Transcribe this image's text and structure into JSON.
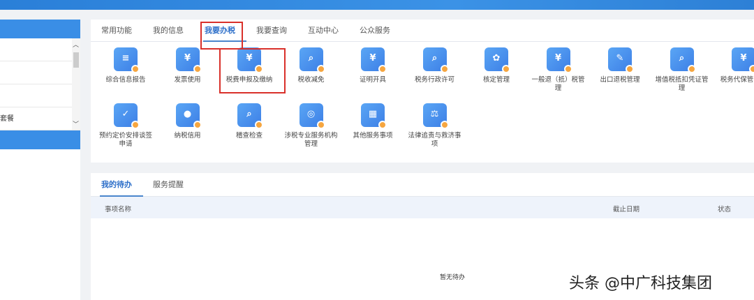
{
  "sidebar": {
    "rows": [
      "",
      "",
      "",
      "套餐"
    ]
  },
  "top_tabs": [
    {
      "label": "常用功能",
      "active": false
    },
    {
      "label": "我的信息",
      "active": false
    },
    {
      "label": "我要办税",
      "active": true
    },
    {
      "label": "我要查询",
      "active": false
    },
    {
      "label": "互动中心",
      "active": false
    },
    {
      "label": "公众服务",
      "active": false
    }
  ],
  "services_row1": [
    {
      "label": "综合信息报告",
      "icon": "report-icon",
      "sym": "≡"
    },
    {
      "label": "发票使用",
      "icon": "invoice-icon",
      "sym": "¥"
    },
    {
      "label": "税费申报及缴纳",
      "icon": "tax-declare-icon",
      "sym": "¥"
    },
    {
      "label": "税收减免",
      "icon": "money-bag-search-icon",
      "sym": "⌕"
    },
    {
      "label": "证明开具",
      "icon": "money-bag-yen-icon",
      "sym": "¥"
    },
    {
      "label": "税务行政许可",
      "icon": "license-icon",
      "sym": "⌕"
    },
    {
      "label": "核定管理",
      "icon": "badge-icon",
      "sym": "✿"
    },
    {
      "label": "一般退（抵）税管理",
      "icon": "refund-box-icon",
      "sym": "¥"
    },
    {
      "label": "出口退税管理",
      "icon": "edit-ticket-icon",
      "sym": "✎"
    },
    {
      "label": "增值税抵扣凭证管理",
      "icon": "voucher-icon",
      "sym": "⌕"
    },
    {
      "label": "税务代保管收取",
      "icon": "money-bag-icon",
      "sym": "¥"
    }
  ],
  "services_row2": [
    {
      "label": "预约定价安排谈签申请",
      "icon": "checklist-icon",
      "sym": "✓"
    },
    {
      "label": "纳税信用",
      "icon": "user-stamp-icon",
      "sym": "●"
    },
    {
      "label": "稽查检查",
      "icon": "inspect-icon",
      "sym": "⌕"
    },
    {
      "label": "涉税专业服务机构管理",
      "icon": "agency-icon",
      "sym": "◎"
    },
    {
      "label": "其他服务事项",
      "icon": "building-icon",
      "sym": "▦"
    },
    {
      "label": "法律追责与救济事项",
      "icon": "gavel-icon",
      "sym": "⚖"
    }
  ],
  "todo": {
    "tabs": [
      {
        "label": "我的待办",
        "active": true
      },
      {
        "label": "服务提醒",
        "active": false
      }
    ],
    "columns": [
      "事项名称",
      "截止日期",
      "状态"
    ],
    "empty_text": "暂无待办"
  },
  "watermark": "头条 @中广科技集团"
}
